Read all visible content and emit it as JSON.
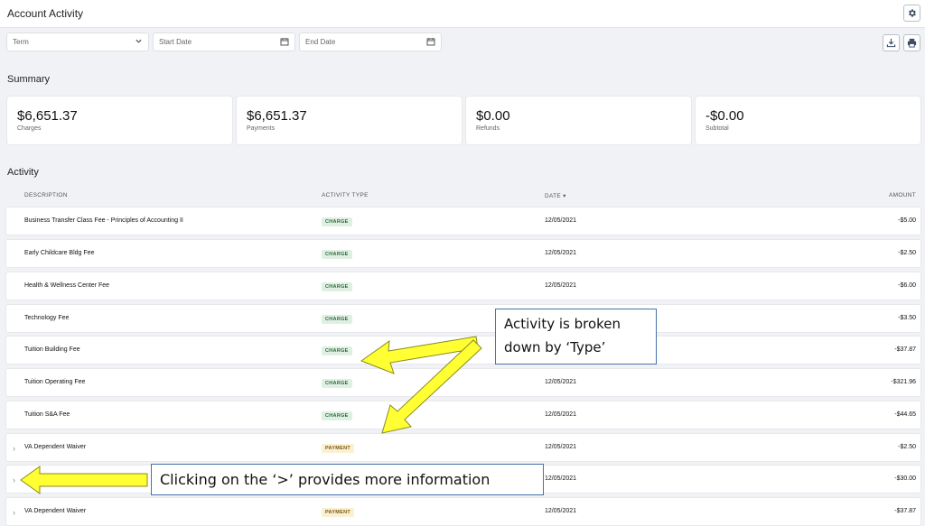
{
  "header": {
    "title": "Account Activity",
    "settings_icon": "gear-icon"
  },
  "filters": {
    "term_placeholder": "Term",
    "start_date_placeholder": "Start Date",
    "end_date_placeholder": "End Date"
  },
  "toolbar": {
    "download_icon": "download-icon",
    "print_icon": "print-icon"
  },
  "summary": {
    "title": "Summary",
    "cards": [
      {
        "amount": "$6,651.37",
        "label": "Charges"
      },
      {
        "amount": "$6,651.37",
        "label": "Payments"
      },
      {
        "amount": "$0.00",
        "label": "Refunds"
      },
      {
        "amount": "-$0.00",
        "label": "Subtotal"
      }
    ]
  },
  "activity": {
    "title": "Activity",
    "columns": {
      "description": "DESCRIPTION",
      "type": "ACTIVITY TYPE",
      "date": "DATE ▾",
      "amount": "AMOUNT"
    },
    "rows": [
      {
        "description": "Business Transfer Class Fee - Principles of Accounting II",
        "type": "CHARGE",
        "date": "12/05/2021",
        "amount": "-$5.00",
        "expandable": false
      },
      {
        "description": "Early Childcare Bldg Fee",
        "type": "CHARGE",
        "date": "12/05/2021",
        "amount": "-$2.50",
        "expandable": false
      },
      {
        "description": "Health & Wellness Center Fee",
        "type": "CHARGE",
        "date": "12/05/2021",
        "amount": "-$6.00",
        "expandable": false
      },
      {
        "description": "Technology Fee",
        "type": "CHARGE",
        "date": "",
        "amount": "-$3.50",
        "expandable": false
      },
      {
        "description": "Tuition Building Fee",
        "type": "CHARGE",
        "date": "",
        "amount": "-$37.87",
        "expandable": false
      },
      {
        "description": "Tuition Operating Fee",
        "type": "CHARGE",
        "date": "12/05/2021",
        "amount": "-$321.96",
        "expandable": false
      },
      {
        "description": "Tuition S&A Fee",
        "type": "CHARGE",
        "date": "12/05/2021",
        "amount": "-$44.65",
        "expandable": false
      },
      {
        "description": "VA Dependent Waiver",
        "type": "PAYMENT",
        "date": "12/05/2021",
        "amount": "-$2.50",
        "expandable": true
      },
      {
        "description": "",
        "type": "",
        "date": "12/05/2021",
        "amount": "-$30.00",
        "expandable": true
      },
      {
        "description": "VA Dependent Waiver",
        "type": "PAYMENT",
        "date": "12/05/2021",
        "amount": "-$37.87",
        "expandable": true
      }
    ]
  },
  "annotations": {
    "type_callout": "Activity is broken down by ‘Type’",
    "chevron_callout": "Clicking on the ‘>’ provides more information"
  },
  "colors": {
    "arrow_fill": "#ffff33",
    "arrow_stroke": "#8a8a20",
    "callout_border": "#4472a8",
    "charge_badge": "#dff0e3",
    "payment_badge": "#fbf0d3"
  }
}
